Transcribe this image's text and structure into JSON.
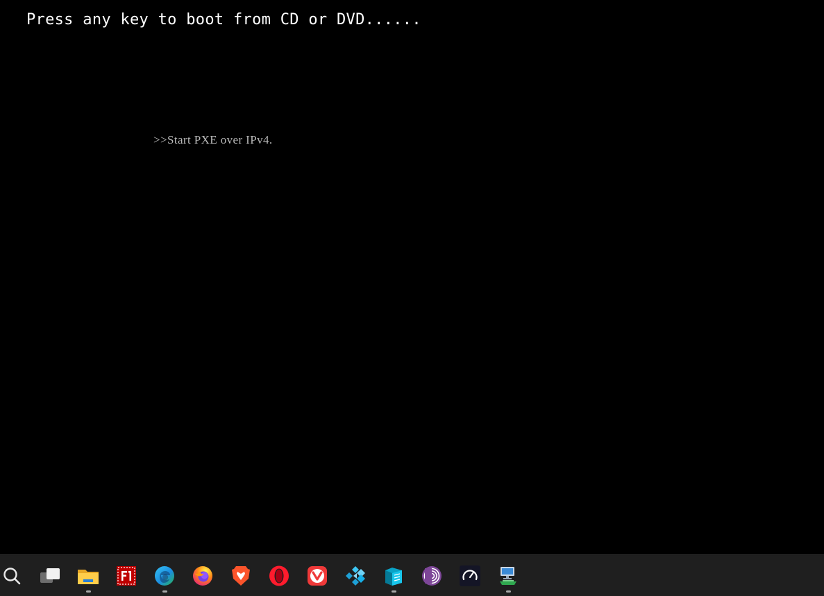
{
  "console": {
    "boot_prompt": "Press any key to boot from CD or DVD......",
    "pxe_message": ">>Start PXE over IPv4."
  },
  "colors": {
    "background": "#000000",
    "boot_text": "#ffffff",
    "pxe_text": "#b8b8b8",
    "taskbar": "#1f1f1f"
  },
  "taskbar": {
    "items": [
      {
        "icon": "search-icon",
        "running": false
      },
      {
        "icon": "task-view-icon",
        "running": false
      },
      {
        "icon": "file-explorer-icon",
        "running": true
      },
      {
        "icon": "filezilla-icon",
        "running": false
      },
      {
        "icon": "edge-icon",
        "running": true
      },
      {
        "icon": "firefox-icon",
        "running": false
      },
      {
        "icon": "brave-icon",
        "running": false
      },
      {
        "icon": "opera-icon",
        "running": false
      },
      {
        "icon": "vivaldi-icon",
        "running": false
      },
      {
        "icon": "kodi-icon",
        "running": false
      },
      {
        "icon": "database-app-icon",
        "running": true
      },
      {
        "icon": "tor-browser-icon",
        "running": false
      },
      {
        "icon": "speedtest-icon",
        "running": false
      },
      {
        "icon": "network-computer-icon",
        "running": true
      }
    ]
  }
}
